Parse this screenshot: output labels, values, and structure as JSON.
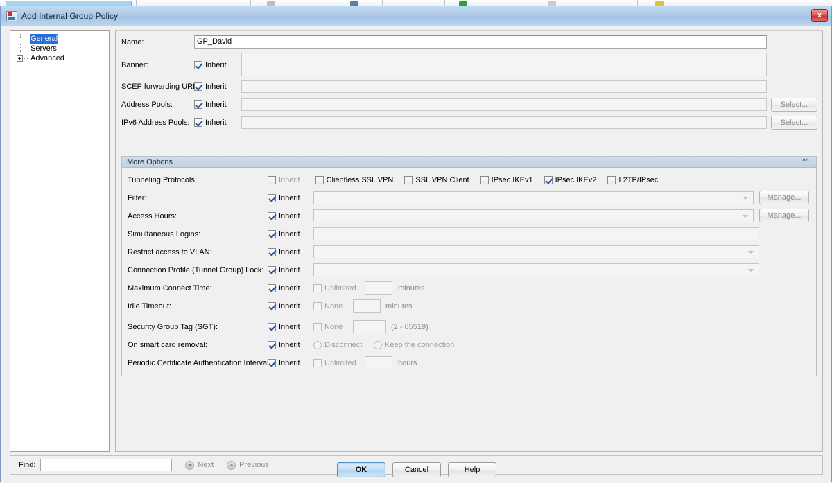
{
  "window": {
    "title": "Add Internal Group Policy",
    "icon": "group-policy-icon",
    "close_label": "x"
  },
  "nav_tree": {
    "items": [
      {
        "label": "General",
        "selected": true,
        "expandable": false
      },
      {
        "label": "Servers",
        "selected": false,
        "expandable": false
      },
      {
        "label": "Advanced",
        "selected": false,
        "expandable": true
      }
    ]
  },
  "form": {
    "name": {
      "label": "Name:",
      "value": "GP_David"
    },
    "banner": {
      "label": "Banner:",
      "inherit_label": "Inherit",
      "inherit_checked": true,
      "value": ""
    },
    "scep_forwarding_url": {
      "label": "SCEP forwarding URL:",
      "inherit_label": "Inherit",
      "inherit_checked": true,
      "value": ""
    },
    "address_pools": {
      "label": "Address Pools:",
      "inherit_label": "Inherit",
      "inherit_checked": true,
      "value": "",
      "button_label": "Select..."
    },
    "ipv6_address_pools": {
      "label": "IPv6 Address Pools:",
      "inherit_label": "Inherit",
      "inherit_checked": true,
      "value": "",
      "button_label": "Select..."
    }
  },
  "more_options": {
    "title": "More Options",
    "collapse_icon": "chevron-double-up-icon",
    "tunneling_protocols": {
      "label": "Tunneling Protocols:",
      "inherit_label": "Inherit",
      "inherit_checked": false,
      "options": [
        {
          "label": "Clientless SSL VPN",
          "checked": false
        },
        {
          "label": "SSL VPN Client",
          "checked": false
        },
        {
          "label": "IPsec IKEv1",
          "checked": false
        },
        {
          "label": "IPsec IKEv2",
          "checked": true
        },
        {
          "label": "L2TP/IPsec",
          "checked": false
        }
      ]
    },
    "filter": {
      "label": "Filter:",
      "inherit_label": "Inherit",
      "inherit_checked": true,
      "value": "",
      "button_label": "Manage..."
    },
    "access_hours": {
      "label": "Access Hours:",
      "inherit_label": "Inherit",
      "inherit_checked": true,
      "value": "",
      "button_label": "Manage..."
    },
    "simultaneous_logins": {
      "label": "Simultaneous Logins:",
      "inherit_label": "Inherit",
      "inherit_checked": true,
      "value": ""
    },
    "restrict_access_to_vlan": {
      "label": "Restrict access to VLAN:",
      "inherit_label": "Inherit",
      "inherit_checked": true,
      "value": ""
    },
    "connection_profile_lock": {
      "label": "Connection Profile (Tunnel Group) Lock:",
      "inherit_label": "Inherit",
      "inherit_checked": true,
      "value": ""
    },
    "maximum_connect_time": {
      "label": "Maximum Connect Time:",
      "inherit_label": "Inherit",
      "inherit_checked": true,
      "option_label": "Unlimited",
      "option_checked": false,
      "value": "",
      "unit": "minutes"
    },
    "idle_timeout": {
      "label": "Idle Timeout:",
      "inherit_label": "Inherit",
      "inherit_checked": true,
      "option_label": "None",
      "option_checked": false,
      "value": "",
      "unit": "minutes"
    },
    "security_group_tag": {
      "label": "Security Group Tag (SGT):",
      "inherit_label": "Inherit",
      "inherit_checked": true,
      "option_label": "None",
      "option_checked": false,
      "value": "",
      "range_hint": "(2 - 65519)"
    },
    "smart_card_removal": {
      "label": "On smart card removal:",
      "inherit_label": "Inherit",
      "inherit_checked": true,
      "radio_disconnect": "Disconnect",
      "radio_keep": "Keep the connection"
    },
    "periodic_cert_auth_interval": {
      "label": "Periodic Certificate Authentication Interval:",
      "inherit_label": "Inherit",
      "inherit_checked": true,
      "option_label": "Unlimited",
      "option_checked": false,
      "value": "",
      "unit": "hours"
    }
  },
  "find_bar": {
    "label": "Find:",
    "value": "",
    "next_label": "Next",
    "previous_label": "Previous"
  },
  "footer": {
    "ok_label": "OK",
    "cancel_label": "Cancel",
    "help_label": "Help"
  },
  "colors": {
    "accent": "#2a6fd6",
    "titlebar": "#aecbe8",
    "close_button": "#cc342c",
    "check": "#21529e"
  }
}
